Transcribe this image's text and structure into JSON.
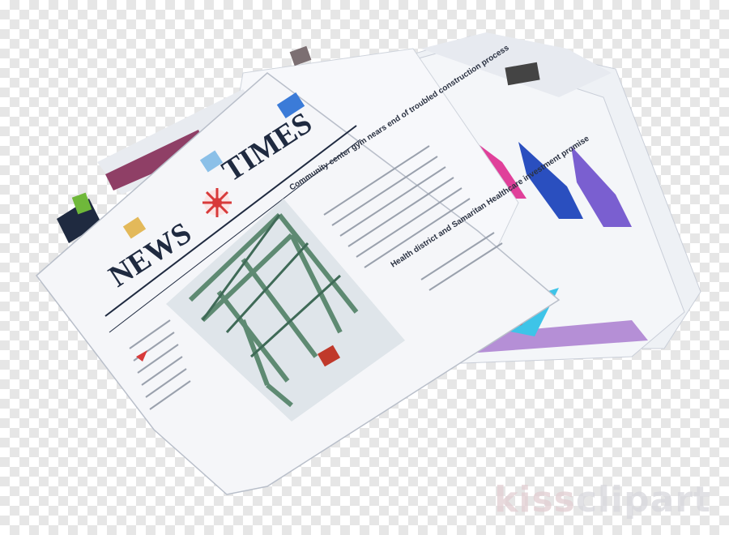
{
  "masthead": {
    "word1": "NEWS",
    "word2": "TIMES"
  },
  "headlines": {
    "lead": "Community center gym nears end of troubled construction process",
    "second": "Health district and Samaritan Healthcare investment promise"
  },
  "watermark": {
    "part1": "kiss",
    "part2": "clipart"
  },
  "colors": {
    "paper": "#f1f3f7",
    "ink": "#1f2a40",
    "bridge": "#5e8a72",
    "magenta": "#e0409a",
    "blue": "#2a4fbf",
    "star": "#d83a3a"
  }
}
